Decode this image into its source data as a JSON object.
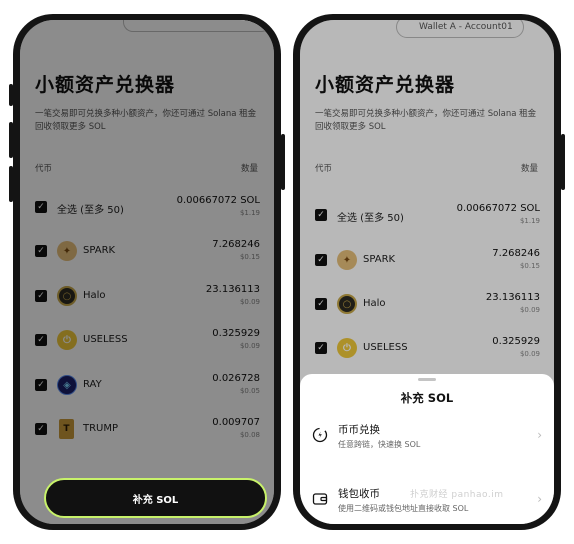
{
  "left_screen": {
    "title": "小额资产兑换器",
    "description": "一笔交易即可兑换多种小额资产，你还可通过 Solana 租金回收领取更多 SOL",
    "col_token": "代币",
    "col_amount": "数量",
    "select_all": {
      "label": "全选 (至多 50)",
      "amount": "0.00667072 SOL",
      "usd": "$1.19"
    },
    "tokens": [
      {
        "name": "SPARK",
        "amount": "7.268246",
        "usd": "$0.15",
        "icon": "spark-token-icon"
      },
      {
        "name": "Halo",
        "amount": "23.136113",
        "usd": "$0.09",
        "icon": "halo-token-icon"
      },
      {
        "name": "USELESS",
        "amount": "0.325929",
        "usd": "$0.09",
        "icon": "useless-token-icon"
      },
      {
        "name": "RAY",
        "amount": "0.026728",
        "usd": "$0.05",
        "icon": "ray-token-icon"
      },
      {
        "name": "TRUMP",
        "amount": "0.009707",
        "usd": "$0.08",
        "icon": "trump-token-icon"
      }
    ],
    "button_label": "补充 SOL",
    "button_border_color": "#c8f26a"
  },
  "right_screen": {
    "wallet_label": "Wallet A - Account01",
    "title": "小额资产兑换器",
    "description": "一笔交易即可兑换多种小额资产，你还可通过 Solana 租金回收领取更多 SOL",
    "col_token": "代币",
    "col_amount": "数量",
    "select_all": {
      "label": "全选 (至多 50)",
      "amount": "0.00667072 SOL",
      "usd": "$1.19"
    },
    "tokens": [
      {
        "name": "SPARK",
        "amount": "7.268246",
        "usd": "$0.15"
      },
      {
        "name": "Halo",
        "amount": "23.136113",
        "usd": "$0.09"
      },
      {
        "name": "USELESS",
        "amount": "0.325929",
        "usd": "$0.09"
      }
    ],
    "sheet": {
      "title": "补充 SOL",
      "options": [
        {
          "title": "币币兑换",
          "subtitle": "任意跨链，快速换 SOL",
          "icon": "swap-icon"
        },
        {
          "title": "钱包收币",
          "subtitle": "使用二维码或钱包地址直接收取 SOL",
          "icon": "wallet-icon"
        }
      ],
      "watermark": "扑克财经 panhao.im"
    }
  }
}
